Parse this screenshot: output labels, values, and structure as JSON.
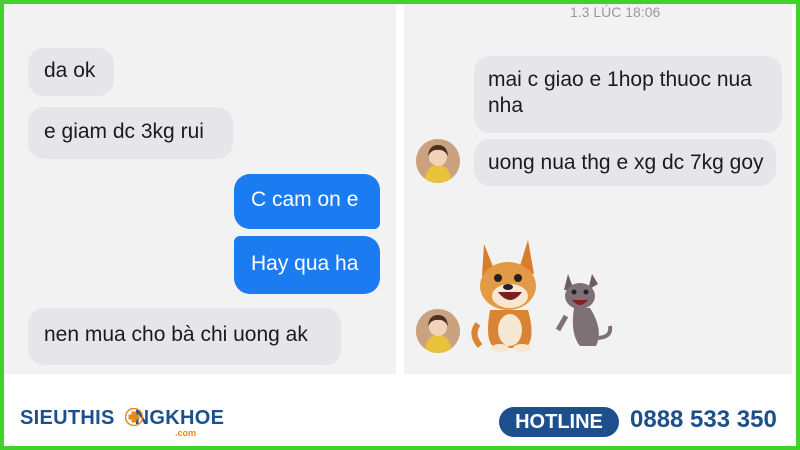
{
  "left_chat": {
    "messages": [
      {
        "text": "da ok",
        "side": "incoming"
      },
      {
        "text": "e giam dc 3kg rui",
        "side": "incoming"
      },
      {
        "text": "C cam on e",
        "side": "outgoing"
      },
      {
        "text": "Hay qua ha",
        "side": "outgoing"
      },
      {
        "text": "nen mua cho bà chi uong ak",
        "side": "incoming"
      }
    ]
  },
  "right_chat": {
    "timestamp": "1.3 LÚC 18:06",
    "messages": [
      {
        "text": "mai c giao e 1hop thuoc nua nha",
        "side": "incoming"
      },
      {
        "text": "uong nua thg e xg dc 7kg goy",
        "side": "incoming"
      }
    ],
    "sticker": "dogs-laughing-sticker"
  },
  "footer": {
    "brand_part1": "SIEUTHIS",
    "brand_part2": "NGKHOE",
    "brand_domain": ".com",
    "hotline_label": "HOTLINE",
    "hotline_number": "0888 533 350"
  },
  "colors": {
    "border": "#3fd22b",
    "outgoing_bubble": "#1a7cf0",
    "incoming_bubble": "#e6e6ea",
    "brand_blue": "#1d4f8d"
  }
}
